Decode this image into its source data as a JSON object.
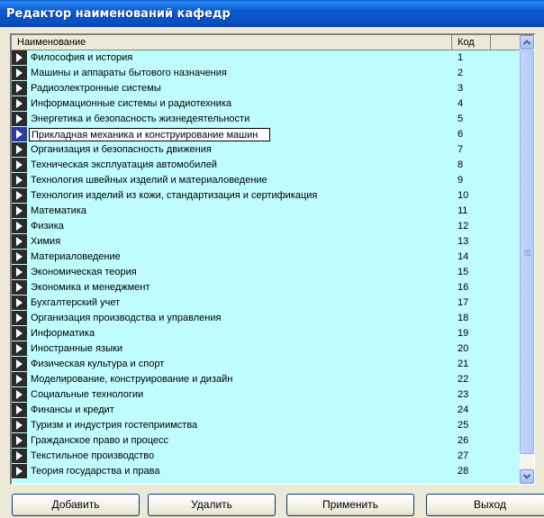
{
  "window": {
    "title": "Редактор наименований кафедр"
  },
  "grid": {
    "columns": [
      "Наименование",
      "Код"
    ],
    "selected_index": 5,
    "rows": [
      {
        "name": "Философия и история",
        "code": "1"
      },
      {
        "name": "Машины и аппараты бытового назначения",
        "code": "2"
      },
      {
        "name": "Радиоэлектронные системы",
        "code": "3"
      },
      {
        "name": "Информационные системы и радиотехника",
        "code": "4"
      },
      {
        "name": "Энергетика и безопасность жизнедеятельности",
        "code": "5"
      },
      {
        "name": "Прикладная механика и конструирование машин",
        "code": "6"
      },
      {
        "name": "Организация и безопасность движения",
        "code": "7"
      },
      {
        "name": "Техническая эксплуатация автомобилей",
        "code": "8"
      },
      {
        "name": "Технология швейных изделий и материаловедение",
        "code": "9"
      },
      {
        "name": "Технология изделий из кожи, стандартизация и сертификация",
        "code": "10"
      },
      {
        "name": "Математика",
        "code": "11"
      },
      {
        "name": "Физика",
        "code": "12"
      },
      {
        "name": "Химия",
        "code": "13"
      },
      {
        "name": "Материаловедение",
        "code": "14"
      },
      {
        "name": "Экономическая теория",
        "code": "15"
      },
      {
        "name": "Экономика и менеджмент",
        "code": "16"
      },
      {
        "name": "Бухгалтерский учет",
        "code": "17"
      },
      {
        "name": "Организация производства и управления",
        "code": "18"
      },
      {
        "name": "Информатика",
        "code": "19"
      },
      {
        "name": "Иностранные языки",
        "code": "20"
      },
      {
        "name": "Физическая культура и спорт",
        "code": "21"
      },
      {
        "name": "Моделирование, конструирование и дизайн",
        "code": "22"
      },
      {
        "name": "Социальные технологии",
        "code": "23"
      },
      {
        "name": "Финансы и кредит",
        "code": "24"
      },
      {
        "name": "Туризм и индустрия гостеприимства",
        "code": "25"
      },
      {
        "name": "Гражданское право и процесс",
        "code": "26"
      },
      {
        "name": "Текстильное производство",
        "code": "27"
      },
      {
        "name": "Теория государства и права",
        "code": "28"
      }
    ]
  },
  "buttons": {
    "add": "Добавить",
    "delete": "Удалить",
    "apply": "Применить",
    "exit": "Выход"
  },
  "colors": {
    "grid_background": "#bffcfd",
    "titlebar": "#0a5fd6",
    "indicator": "#2b2b2b",
    "selected_indicator": "#2f3a9c"
  }
}
